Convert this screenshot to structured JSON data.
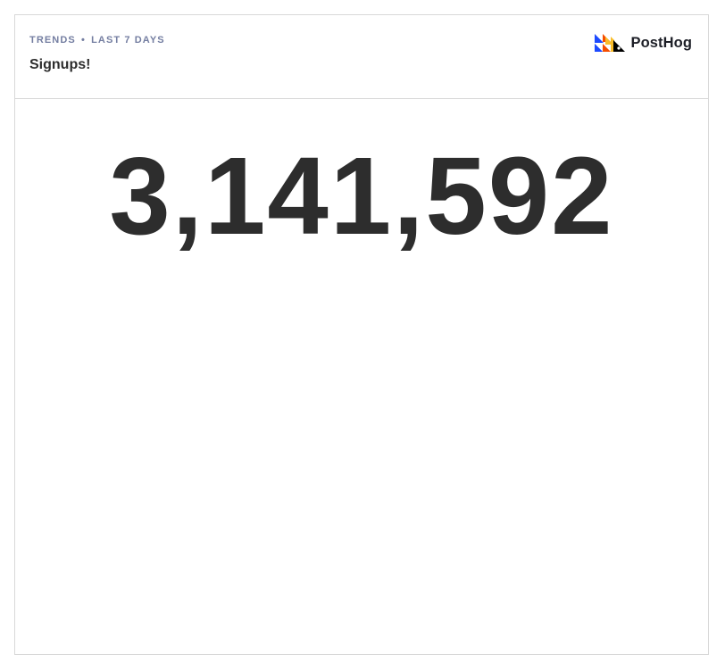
{
  "card": {
    "eyebrow": {
      "kind": "TRENDS",
      "separator": "•",
      "range": "LAST 7 DAYS"
    },
    "title": "Signups!",
    "brand": {
      "logo_icon": "posthog-hedgehog-logo-icon",
      "name": "PostHog"
    },
    "metric_value": "3,141,592"
  },
  "colors": {
    "eyebrow_text": "#747ea1",
    "title_text": "#2d2d2d",
    "metric_text": "#2d2d2d",
    "border": "#d8d8d8",
    "logo_blue": "#1d4aff",
    "logo_orange": "#f54e00",
    "logo_yellow": "#f9bd2b",
    "logo_black": "#000000"
  }
}
